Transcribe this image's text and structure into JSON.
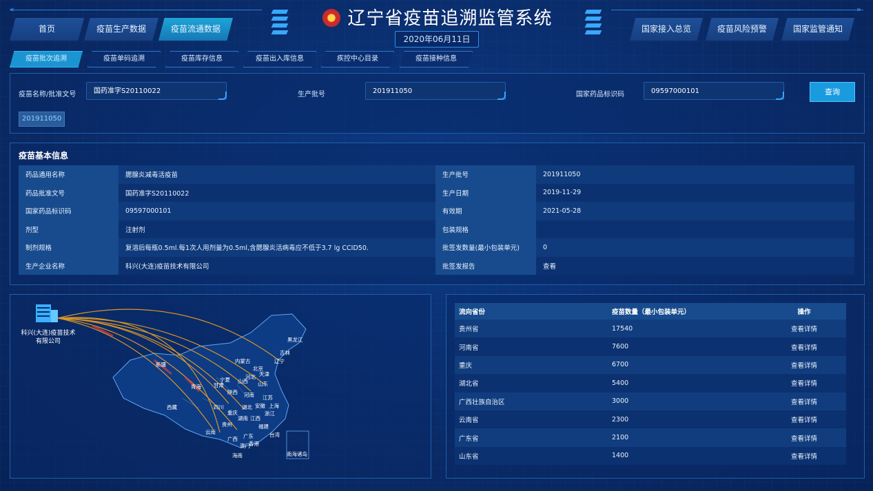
{
  "header": {
    "title": "辽宁省疫苗追溯监管系统",
    "date": "2020年06月11日",
    "nav_left": [
      "首页",
      "疫苗生产数据",
      "疫苗流通数据"
    ],
    "nav_right": [
      "国家接入总览",
      "疫苗风险预警",
      "国家监管通知"
    ],
    "active_nav": "疫苗流通数据"
  },
  "subtabs": [
    "疫苗批次追溯",
    "疫苗单码追溯",
    "疫苗库存信息",
    "疫苗出入库信息",
    "疾控中心目录",
    "疫苗接种信息"
  ],
  "search": {
    "name_label": "疫苗名称/批准文号",
    "name_value": "国药准字S20110022",
    "batch_label": "生产批号",
    "batch_value": "201911050",
    "code_label": "国家药品标识码",
    "code_value": "09597000101",
    "query_button": "查询",
    "chip": "201911050"
  },
  "basic_info": {
    "title": "疫苗基本信息",
    "rows": [
      {
        "k1": "药品通用名称",
        "v1": "腮腺炎减毒活疫苗",
        "k2": "生产批号",
        "v2": "201911050"
      },
      {
        "k1": "药品批准文号",
        "v1": "国药准字S20110022",
        "k2": "生产日期",
        "v2": "2019-11-29"
      },
      {
        "k1": "国家药品标识码",
        "v1": "09597000101",
        "k2": "有效期",
        "v2": "2021-05-28"
      },
      {
        "k1": "剂型",
        "v1": "注射剂",
        "k2": "包装规格",
        "v2": ""
      },
      {
        "k1": "制剂规格",
        "v1": "复溶后每瓶0.5ml.每1次人用剂量为0.5ml,含腮腺炎活病毒应不低于3.7 lg CCID50.",
        "k2": "批签发数量(最小包装单元)",
        "v2": "0"
      },
      {
        "k1": "生产企业名称",
        "v1": "科兴(大连)疫苗技术有限公司",
        "k2": "批签发报告",
        "v2": "查看"
      }
    ]
  },
  "map": {
    "company_label_1": "科兴(大连)疫苗技术",
    "company_label_2": "有限公司",
    "province_labels": [
      "黑龙江",
      "吉林",
      "辽宁",
      "内蒙古",
      "北京",
      "天津",
      "河北",
      "山西",
      "山东",
      "宁夏",
      "甘肃",
      "青海",
      "陕西",
      "河南",
      "江苏",
      "上海",
      "安徽",
      "湖北",
      "浙江",
      "新疆",
      "西藏",
      "四川",
      "重庆",
      "湖南",
      "江西",
      "福建",
      "贵州",
      "云南",
      "广西",
      "广东",
      "台湾",
      "澳门",
      "香港",
      "海南",
      "南海诸岛"
    ]
  },
  "destinations": {
    "columns": [
      "流向省份",
      "疫苗数量（最小包装单元）",
      "操作"
    ],
    "rows": [
      {
        "province": "贵州省",
        "count": "17540",
        "action": "查看详情"
      },
      {
        "province": "河南省",
        "count": "7600",
        "action": "查看详情"
      },
      {
        "province": "重庆",
        "count": "6700",
        "action": "查看详情"
      },
      {
        "province": "湖北省",
        "count": "5400",
        "action": "查看详情"
      },
      {
        "province": "广西壮族自治区",
        "count": "3000",
        "action": "查看详情"
      },
      {
        "province": "云南省",
        "count": "2300",
        "action": "查看详情"
      },
      {
        "province": "广东省",
        "count": "2100",
        "action": "查看详情"
      },
      {
        "province": "山东省",
        "count": "1400",
        "action": "查看详情"
      }
    ]
  },
  "colors": {
    "accent": "#1a9be0",
    "active_tab": "#1ea5d7",
    "link": "#39b4ff",
    "flow_line": "#f0a020"
  }
}
